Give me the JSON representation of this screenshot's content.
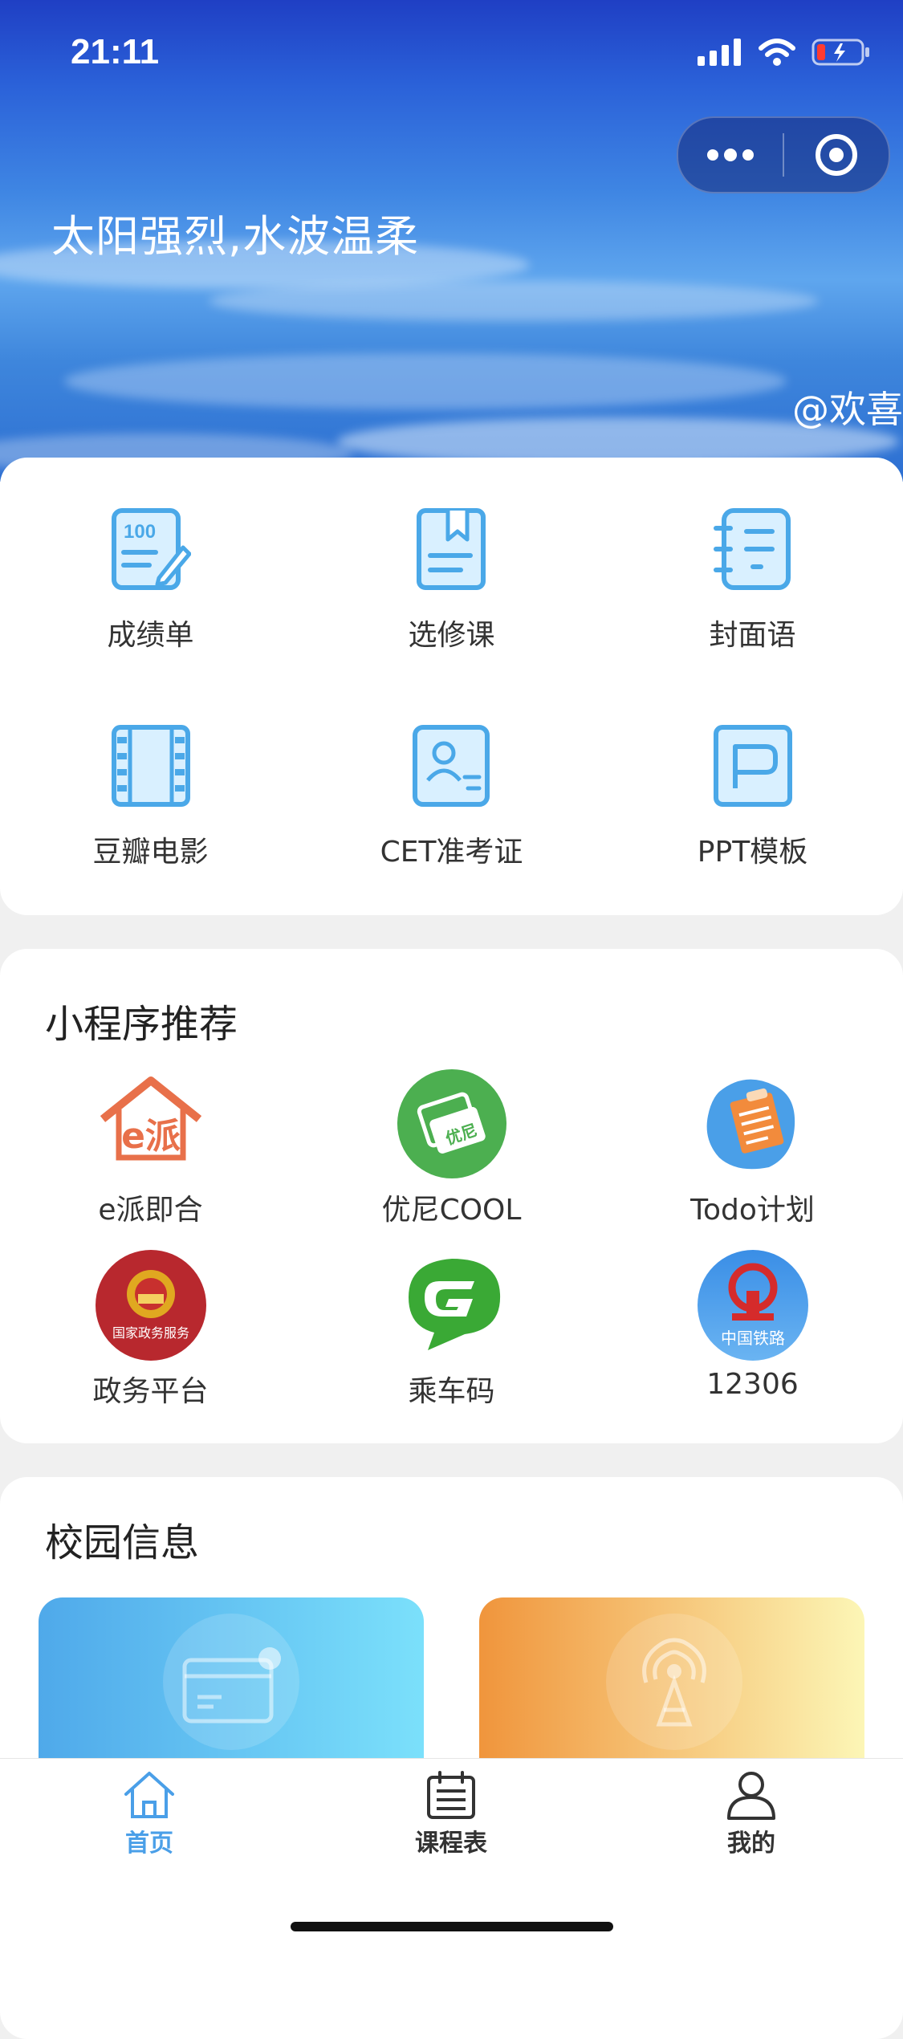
{
  "status_bar": {
    "time": "21:11"
  },
  "hero": {
    "title": "太阳强烈,水波温柔",
    "credit": "@欢喜"
  },
  "tools": [
    {
      "label": "成绩单",
      "icon": "report-card-icon"
    },
    {
      "label": "选修课",
      "icon": "bookmark-book-icon"
    },
    {
      "label": "封面语",
      "icon": "notebook-icon"
    },
    {
      "label": "豆瓣电影",
      "icon": "film-strip-icon"
    },
    {
      "label": "CET准考证",
      "icon": "id-card-icon"
    },
    {
      "label": "PPT模板",
      "icon": "ppt-icon"
    }
  ],
  "mini_programs": {
    "title": "小程序推荐",
    "items": [
      {
        "label": "e派即合",
        "icon": "epai-logo-icon",
        "logo_text": "e派"
      },
      {
        "label": "优尼COOL",
        "icon": "youni-logo-icon",
        "logo_text": "优尼"
      },
      {
        "label": "Todo计划",
        "icon": "todo-logo-icon"
      },
      {
        "label": "政务平台",
        "icon": "gov-service-logo-icon",
        "logo_text": "国家政务服务"
      },
      {
        "label": "乘车码",
        "icon": "ride-code-logo-icon"
      },
      {
        "label": "12306",
        "icon": "railway-logo-icon",
        "logo_text": "中国铁路"
      }
    ]
  },
  "campus": {
    "title": "校园信息"
  },
  "tabbar": {
    "active_color": "#4a9fe8",
    "items": [
      {
        "label": "首页",
        "icon": "home-icon",
        "active": true
      },
      {
        "label": "课程表",
        "icon": "calendar-icon",
        "active": false
      },
      {
        "label": "我的",
        "icon": "user-icon",
        "active": false
      }
    ]
  }
}
